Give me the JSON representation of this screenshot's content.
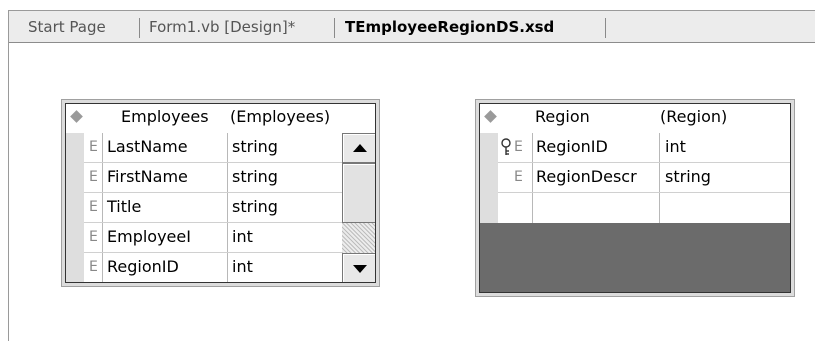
{
  "tabs": [
    {
      "label": "Start Page",
      "active": false
    },
    {
      "label": "Form1.vb [Design]*",
      "active": false
    },
    {
      "label": "TEmployeeRegionDS.xsd",
      "active": true
    }
  ],
  "tables": {
    "employees": {
      "name": "Employees",
      "type": "(Employees)",
      "rows": [
        {
          "marker": "E",
          "name": "LastName",
          "type": "string"
        },
        {
          "marker": "E",
          "name": "FirstName",
          "type": "string"
        },
        {
          "marker": "E",
          "name": "Title",
          "type": "string"
        },
        {
          "marker": "E",
          "name": "EmployeeI",
          "type": "int"
        },
        {
          "marker": "E",
          "name": "RegionID",
          "type": "int"
        }
      ]
    },
    "region": {
      "name": "Region",
      "type": "(Region)",
      "rows": [
        {
          "marker": "E",
          "name": "RegionID",
          "type": "int",
          "primary_key": true
        },
        {
          "marker": "E",
          "name": "RegionDescr",
          "type": "string"
        },
        {
          "marker": "",
          "name": "",
          "type": ""
        }
      ]
    }
  },
  "colors": {
    "tab_strip": "#ececec",
    "empty_area": "#6b6b6b",
    "row_gutter": "#dedede"
  }
}
